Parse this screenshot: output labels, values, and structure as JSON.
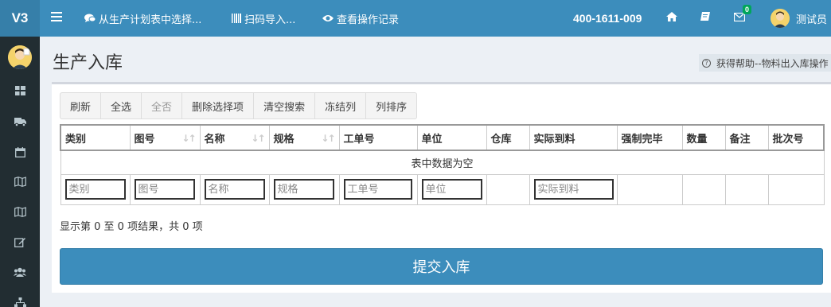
{
  "app": {
    "logo": "V3"
  },
  "topbar": {
    "menu_icon": "hamburger-icon",
    "items": [
      {
        "icon": "comments-icon",
        "label": "从生产计划表中选择..."
      },
      {
        "icon": "barcode-icon",
        "label": "扫码导入..."
      },
      {
        "icon": "eye-icon",
        "label": "查看操作记录"
      }
    ],
    "phone": "400-1611-009",
    "mail_badge": "0",
    "user_name": "测试员"
  },
  "sidebar": {
    "icons": [
      "dashboard-icon",
      "truck-icon",
      "calendar-icon",
      "map-icon",
      "map-icon",
      "edit-icon",
      "users-icon",
      "sitemap-icon"
    ]
  },
  "page": {
    "title": "生产入库",
    "help": "获得帮助--物料出入库操作"
  },
  "toolbar": {
    "buttons": [
      {
        "label": "刷新",
        "disabled": false
      },
      {
        "label": "全选",
        "disabled": false
      },
      {
        "label": "全否",
        "disabled": true
      },
      {
        "label": "删除选择项",
        "disabled": false
      },
      {
        "label": "清空搜索",
        "disabled": false
      },
      {
        "label": "冻结列",
        "disabled": false
      },
      {
        "label": "列排序",
        "disabled": false
      }
    ]
  },
  "table": {
    "columns": [
      "类别",
      "图号",
      "名称",
      "规格",
      "工单号",
      "单位",
      "仓库",
      "实际到料",
      "强制完毕",
      "数量",
      "备注",
      "批次号"
    ],
    "empty_text": "表中数据为空",
    "filters": [
      "类别",
      "图号",
      "名称",
      "规格",
      "工单号",
      "单位",
      "",
      "实际到料",
      "",
      "",
      "",
      ""
    ]
  },
  "info": "显示第 0 至 0 项结果，共 0 项",
  "submit_label": "提交入库",
  "colors": {
    "primary": "#3c8dbc",
    "primary_dark": "#367fa9",
    "sidebar": "#222d32",
    "badge": "#00a65a"
  }
}
